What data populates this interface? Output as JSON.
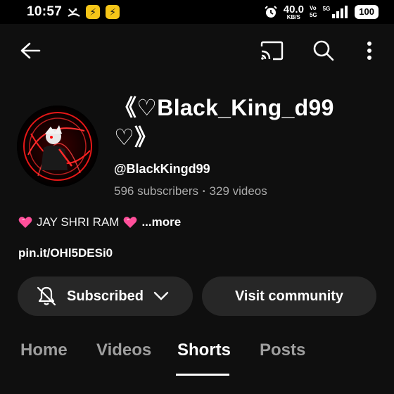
{
  "status_bar": {
    "time": "10:57",
    "speed_value": "40.0",
    "speed_unit": "KB/S",
    "volte_top": "Vo",
    "volte_bottom": "5G",
    "network": "5G",
    "battery": "100",
    "app_badge_glyph": "⚡"
  },
  "app_bar": {
    "back_icon": "back-arrow-icon",
    "cast_icon": "cast-icon",
    "search_icon": "search-icon",
    "more_icon": "more-vert-icon"
  },
  "channel": {
    "name": "《♡Black_King_d99 ♡》",
    "handle": "@BlackKingd99",
    "subscribers": "596 subscribers",
    "separator": "•",
    "videos": "329 videos",
    "description": "JAY SHRI RAM",
    "more_label": "...more",
    "link": "pin.it/OHl5DESi0"
  },
  "actions": {
    "subscribed_label": "Subscribed",
    "visit_label": "Visit community"
  },
  "tabs": [
    {
      "label": "Home",
      "active": false
    },
    {
      "label": "Videos",
      "active": false
    },
    {
      "label": "Shorts",
      "active": true
    },
    {
      "label": "Posts",
      "active": false
    }
  ],
  "colors": {
    "background": "#0f0f0f",
    "button_bg": "#272727",
    "muted_text": "#aaaaaa",
    "heart_pink": "#ff4f9a"
  }
}
